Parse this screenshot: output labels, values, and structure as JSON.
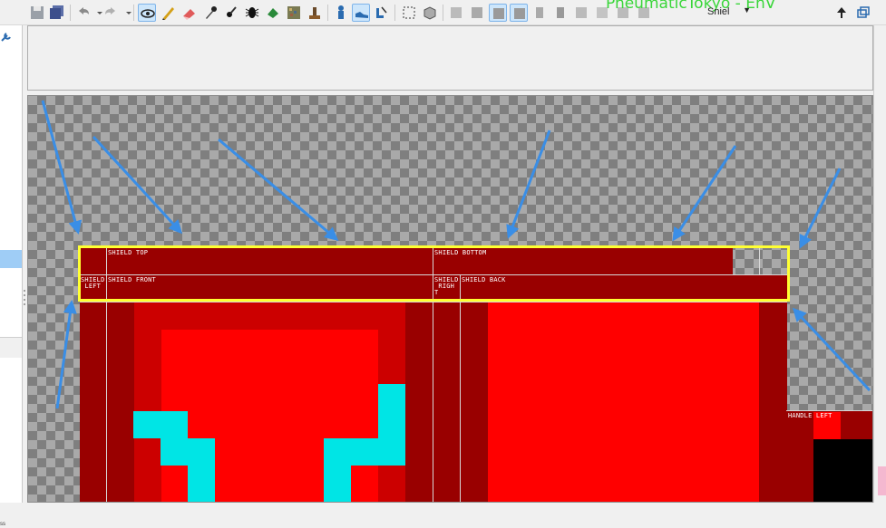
{
  "app": {
    "title": "PneumaticTokyo - EnV"
  },
  "toolbar": {
    "layer_select": {
      "value": "Sniel"
    },
    "icons": [
      "save-icon",
      "save-all-icon",
      "undo-icon",
      "undo-dropdown-icon",
      "redo-icon",
      "redo-dropdown-icon",
      "eye-icon",
      "pencil-icon",
      "eraser-icon",
      "eyedropper-icon",
      "brush-icon",
      "bug-icon",
      "fill-icon",
      "noise-icon",
      "stamp-icon",
      "person-icon",
      "shoe-icon",
      "boots-icon",
      "select-icon",
      "cube-icon",
      "view1-icon",
      "view2-icon",
      "view3-icon",
      "view4-icon",
      "view5-icon",
      "view6-icon",
      "view7-icon",
      "view8-icon",
      "view9-icon",
      "view10-icon",
      "up-arrow-icon",
      "restore-icon"
    ]
  },
  "texture_labels": {
    "shield_top": "SHIELD TOP",
    "shield_bottom": "SHIELD BOTTOM",
    "shield_left": "SHIELD\n LEFT",
    "shield_front": "SHIELD FRONT",
    "shield_right": "SHIELD\n RIGH\nT",
    "shield_back": "SHIELD BACK",
    "handle_left": "HANDLE LEFT"
  },
  "colors": {
    "dark_red": "#990000",
    "red": "#cc0000",
    "bright_red": "#ff0000",
    "cyan": "#00e5e5",
    "highlight": "#ffff33",
    "arrow": "#3a8ee6"
  },
  "status": {
    "text": "ss"
  }
}
